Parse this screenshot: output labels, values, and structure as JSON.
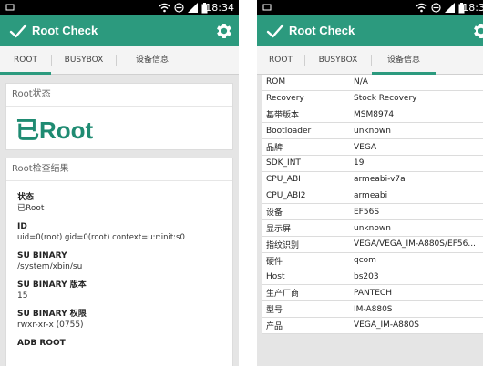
{
  "status_time": "18:34",
  "app_title": "Root Check",
  "tabs": [
    "ROOT",
    "BUSYBOX",
    "设备信息"
  ],
  "colors": {
    "accent": "#2c9a7e",
    "root_text": "#1f8b72"
  },
  "left_screen": {
    "active_tab": "ROOT",
    "root_status_card": {
      "title": "Root状态",
      "value": "已Root"
    },
    "results_card": {
      "title": "Root检查结果",
      "fields": [
        {
          "label": "状态",
          "value": "已Root"
        },
        {
          "label": "ID",
          "value": "uid=0(root) gid=0(root) context=u:r:init:s0"
        },
        {
          "label": "SU BINARY",
          "value": "/system/xbin/su"
        },
        {
          "label": "SU BINARY 版本",
          "value": "15"
        },
        {
          "label": "SU BINARY 权限",
          "value": "rwxr-xr-x (0755)"
        },
        {
          "label": "ADB ROOT",
          "value": ""
        }
      ]
    }
  },
  "right_screen": {
    "active_tab": "设备信息",
    "device_info": [
      {
        "key": "ROM",
        "value": "N/A"
      },
      {
        "key": "Recovery",
        "value": "Stock Recovery"
      },
      {
        "key": "基带版本",
        "value": "MSM8974"
      },
      {
        "key": "Bootloader",
        "value": "unknown"
      },
      {
        "key": "品牌",
        "value": "VEGA"
      },
      {
        "key": "SDK_INT",
        "value": "19"
      },
      {
        "key": "CPU_ABI",
        "value": "armeabi-v7a"
      },
      {
        "key": "CPU_ABI2",
        "value": "armeabi"
      },
      {
        "key": "设备",
        "value": "EF56S"
      },
      {
        "key": "显示屏",
        "value": "unknown"
      },
      {
        "key": "指纹识别",
        "value": "VEGA/VEGA_IM-A880S/EF56..."
      },
      {
        "key": "硬件",
        "value": "qcom"
      },
      {
        "key": "Host",
        "value": "bs203"
      },
      {
        "key": "生产厂商",
        "value": "PANTECH"
      },
      {
        "key": "型号",
        "value": "IM-A880S"
      },
      {
        "key": "产品",
        "value": "VEGA_IM-A880S"
      }
    ]
  }
}
